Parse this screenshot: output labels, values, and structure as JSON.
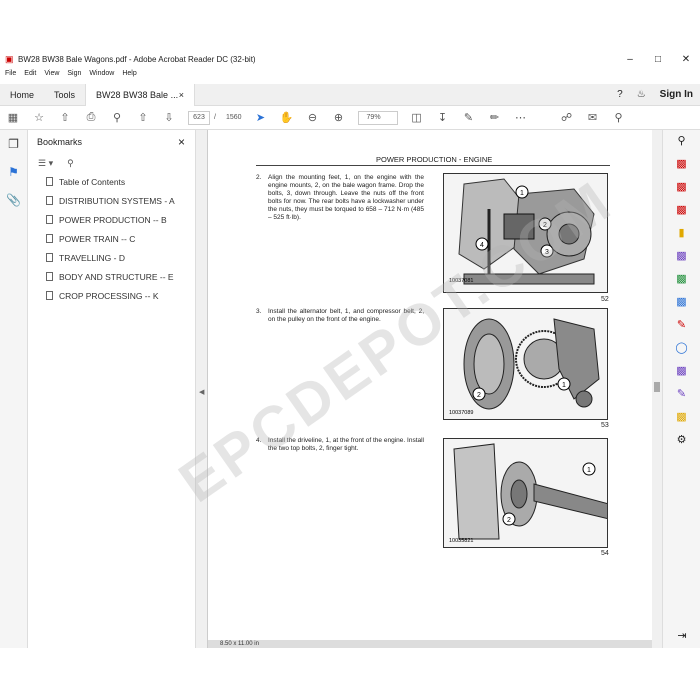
{
  "window": {
    "title": "BW28 BW38 Bale Wagons.pdf - Adobe Acrobat Reader DC (32-bit)",
    "minimize": "–",
    "maximize": "□",
    "close": "✕"
  },
  "menu": [
    "File",
    "Edit",
    "View",
    "Sign",
    "Window",
    "Help"
  ],
  "tabs": {
    "home": "Home",
    "tools": "Tools",
    "document": "BW28 BW38 Bale ...",
    "document_close": "×",
    "help_icon": "?",
    "bell_icon": "🔔",
    "sign_in": "Sign In"
  },
  "toolbar": {
    "current_page": "623",
    "page_separator": "/",
    "page_total": "1560",
    "zoom": "79%"
  },
  "bookmarks": {
    "title": "Bookmarks",
    "close": "×",
    "items": [
      "Table of Contents",
      "DISTRIBUTION SYSTEMS - A",
      "POWER PRODUCTION -- B",
      "POWER TRAIN -- C",
      "TRAVELLING - D",
      "BODY AND STRUCTURE -- E",
      "CROP PROCESSING -- K"
    ]
  },
  "document": {
    "header": "POWER PRODUCTION - ENGINE",
    "steps": [
      {
        "num": "2.",
        "text": "Align the mounting feet, 1, on the engine with the engine mounts, 2, on the bale wagon frame. Drop the bolts, 3, down through. Leave the nuts off the front bolts for now. The rear bolts have a lockwasher under the nuts, they must be torqued to 658 – 712 N·m (485 – 525 ft·lb).",
        "fig_code": "10037081",
        "fig_number": "52",
        "callouts": [
          "1",
          "2",
          "3",
          "4"
        ]
      },
      {
        "num": "3.",
        "text": "Install the alternator belt, 1, and compressor belt, 2, on the pulley on the front of the engine.",
        "fig_code": "10037089",
        "fig_number": "53",
        "callouts": [
          "1",
          "2"
        ]
      },
      {
        "num": "4.",
        "text": "Install the driveline, 1, at the front of the engine. Install the two top bolts, 2, finger tight.",
        "fig_code": "10035821",
        "fig_number": "54",
        "callouts": [
          "1",
          "2"
        ]
      }
    ],
    "page_size": "8.50 x 11.00 in"
  },
  "watermark": "EPCDEPOT.COM",
  "colors": {
    "accent_red": "#cc0000",
    "accent_blue": "#2b72d6"
  }
}
